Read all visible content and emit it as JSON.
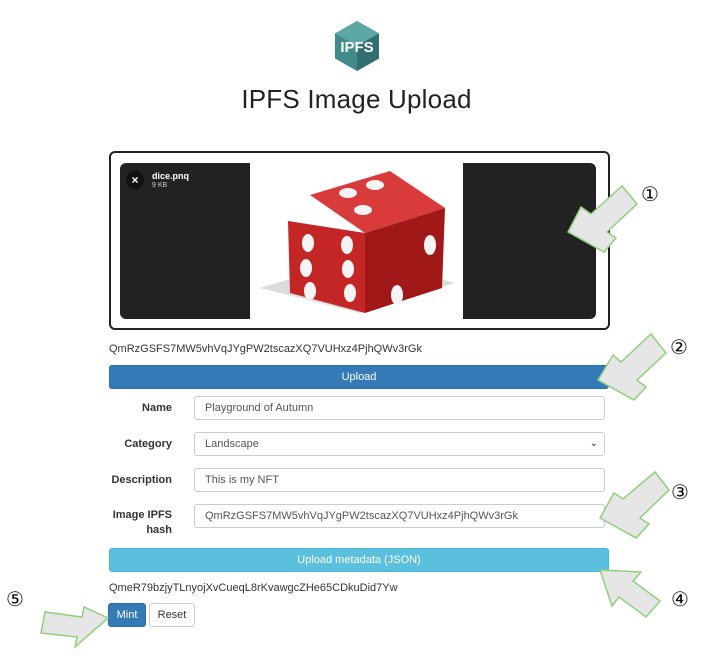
{
  "header": {
    "logo_text": "IPFS",
    "title": "IPFS Image Upload"
  },
  "dropzone": {
    "file_name": "dice.pnq",
    "file_size": "9 KB",
    "remove_icon": "×"
  },
  "image_hash": "QmRzGSFS7MW5vhVqJYgPW2tscazXQ7VUHxz4PjhQWv3rGk",
  "upload_button": "Upload",
  "form": {
    "name_label": "Name",
    "name_value": "Playground of Autumn",
    "category_label": "Category",
    "category_value": "Landscape",
    "description_label": "Description",
    "description_value": "This is my NFT",
    "hash_label_line1": "Image IPFS",
    "hash_label_line2": "hash",
    "hash_value": "QmRzGSFS7MW5vhVqJYgPW2tscazXQ7VUHxz4PjhQWv3rGk"
  },
  "metadata_button": "Upload metadata (JSON)",
  "metadata_hash": "QmeR79bzjyTLnyojXvCueqL8rKvawgcZHe65CDkuDid7Yw",
  "mint_button": "Mint",
  "reset_button": "Reset",
  "annotations": {
    "n1": "①",
    "n2": "②",
    "n3": "③",
    "n4": "④",
    "n5": "⑤"
  },
  "colors": {
    "primary": "#337ab7",
    "info": "#5bc0de",
    "logo": "#3f8a8a",
    "arrow_fill": "#e6e6e6",
    "arrow_stroke": "#8fd07a"
  }
}
